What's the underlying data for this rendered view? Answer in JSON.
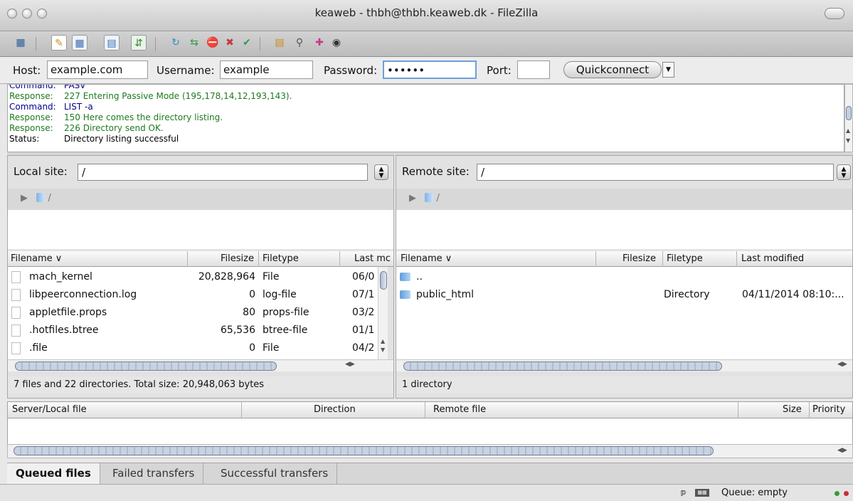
{
  "window": {
    "title": "keaweb - thbh@thbh.keaweb.dk - FileZilla"
  },
  "toolbar": {
    "icons": [
      "site-manager-icon",
      "toggle-log-icon",
      "toggle-local-tree-icon",
      "toggle-remote-tree-icon",
      "toggle-queue-icon",
      "refresh-icon",
      "process-queue-icon",
      "cancel-icon",
      "disconnect-icon",
      "reconnect-icon",
      "filter-icon",
      "compare-icon",
      "sync-browse-icon",
      "search-icon"
    ]
  },
  "quickconnect": {
    "host_label": "Host:",
    "host_value": "example.com",
    "username_label": "Username:",
    "username_value": "example",
    "password_label": "Password:",
    "password_value": "••••••",
    "port_label": "Port:",
    "port_value": "",
    "button_label": "Quickconnect"
  },
  "log": [
    {
      "key": "Command:",
      "text": "PASV",
      "type": "cmd"
    },
    {
      "key": "Response:",
      "text": "227 Entering Passive Mode (195,178,14,12,193,143).",
      "type": "resp"
    },
    {
      "key": "Command:",
      "text": "LIST -a",
      "type": "cmd"
    },
    {
      "key": "Response:",
      "text": "150 Here comes the directory listing.",
      "type": "resp"
    },
    {
      "key": "Response:",
      "text": "226 Directory send OK.",
      "type": "resp"
    },
    {
      "key": "Status:",
      "text": "Directory listing successful",
      "type": "stat"
    }
  ],
  "local": {
    "site_label": "Local site:",
    "path": "/",
    "tree_root": "/",
    "columns": [
      "Filename",
      "Filesize",
      "Filetype",
      "Last mc"
    ],
    "files": [
      {
        "name": "mach_kernel",
        "size": "20,828,964",
        "type": "File",
        "modified": "06/0"
      },
      {
        "name": "libpeerconnection.log",
        "size": "0",
        "type": "log-file",
        "modified": "07/1"
      },
      {
        "name": "appletfile.props",
        "size": "80",
        "type": "props-file",
        "modified": "03/2"
      },
      {
        "name": ".hotfiles.btree",
        "size": "65,536",
        "type": "btree-file",
        "modified": "01/1"
      },
      {
        "name": ".file",
        "size": "0",
        "type": "File",
        "modified": "04/2"
      }
    ],
    "status": "7 files and 22 directories. Total size: 20,948,063 bytes"
  },
  "remote": {
    "site_label": "Remote site:",
    "path": "/",
    "tree_root": "/",
    "columns": [
      "Filename",
      "Filesize",
      "Filetype",
      "Last modified"
    ],
    "files": [
      {
        "name": "..",
        "size": "",
        "type": "",
        "modified": ""
      },
      {
        "name": "public_html",
        "size": "",
        "type": "Directory",
        "modified": "04/11/2014 08:10:..."
      }
    ],
    "status": "1 directory"
  },
  "queue": {
    "columns": [
      "Server/Local file",
      "Direction",
      "Remote file",
      "Size",
      "Priority"
    ],
    "tabs": [
      "Queued files",
      "Failed transfers",
      "Successful transfers"
    ]
  },
  "statusbar": {
    "queue": "Queue: empty"
  },
  "colors": {
    "command": "#00008a",
    "response": "#1d7a1d",
    "led_green": "#3c9a3c",
    "led_red": "#c83030"
  }
}
